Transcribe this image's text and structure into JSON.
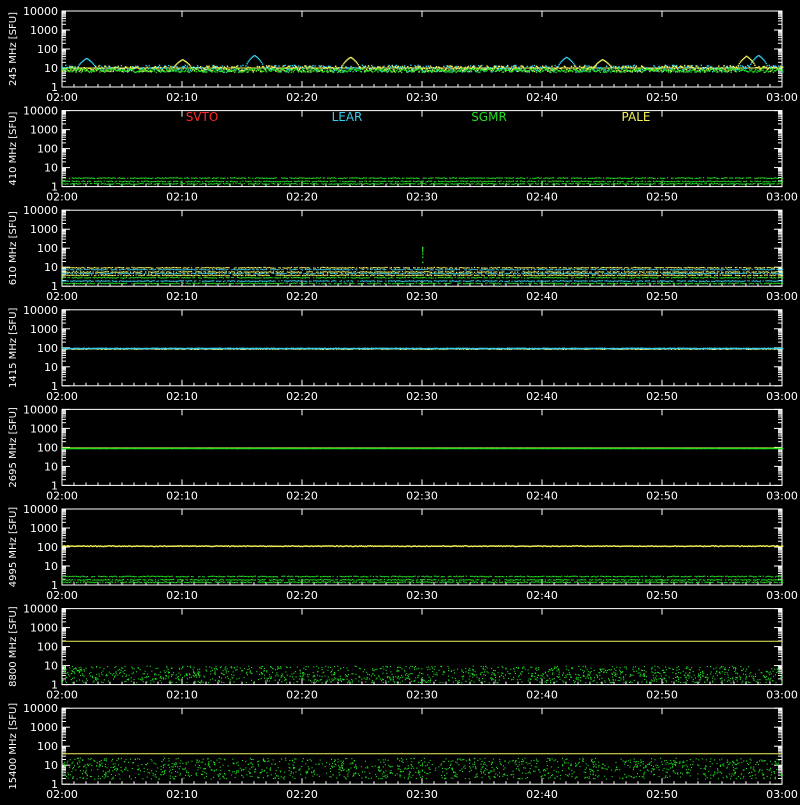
{
  "legend": {
    "items": [
      {
        "label": "SVTO",
        "color": "#ff2a2a"
      },
      {
        "label": "LEAR",
        "color": "#33ccee"
      },
      {
        "label": "SGMR",
        "color": "#22dd22"
      },
      {
        "label": "PALE",
        "color": "#f2f25a"
      }
    ]
  },
  "chart_data": {
    "type": "scatter",
    "x_ticks": [
      "02:00",
      "02:10",
      "02:20",
      "02:30",
      "02:40",
      "02:50",
      "03:00"
    ],
    "xlim_minutes": [
      0,
      60
    ],
    "y_scale": "log",
    "ylim": [
      1,
      10000
    ],
    "y_ticks": [
      "10000",
      "1000",
      "100",
      "10",
      "1"
    ],
    "y_tick_values": [
      10000,
      1000,
      100,
      10,
      1
    ],
    "panels": [
      {
        "ylabel": "245 MHz [SFU]",
        "baseline": 10,
        "series": [
          {
            "name": "LEAR",
            "level": 10,
            "noise": 0.18,
            "spikes": [
              [
                2,
                35
              ],
              [
                16,
                50
              ],
              [
                42,
                40
              ],
              [
                58,
                50
              ]
            ]
          },
          {
            "name": "PALE",
            "level": 10,
            "noise": 0.15,
            "spikes": [
              [
                10,
                30
              ],
              [
                24,
                40
              ],
              [
                45,
                30
              ],
              [
                57,
                45
              ]
            ]
          },
          {
            "name": "SGMR",
            "level": 8,
            "noise": 0.1
          }
        ]
      },
      {
        "ylabel": "410 MHz [SFU]",
        "baseline": null,
        "series": [
          {
            "name": "SGMR",
            "bands": [
              2,
              3,
              1.5
            ]
          }
        ]
      },
      {
        "ylabel": "610 MHz [SFU]",
        "baseline": null,
        "series": [
          {
            "name": "PALE",
            "bands": [
              10,
              6,
              4
            ]
          },
          {
            "name": "LEAR",
            "bands": [
              8,
              5,
              2
            ]
          },
          {
            "name": "SGMR",
            "bands": [
              3,
              1.5
            ],
            "spikes": [
              [
                30,
                120
              ]
            ]
          }
        ]
      },
      {
        "ylabel": "1415 MHz [SFU]",
        "baseline": null,
        "series": [
          {
            "name": "PALE",
            "level": 95,
            "noise": 0.02
          },
          {
            "name": "LEAR",
            "level": 100,
            "noise": 0.015
          }
        ]
      },
      {
        "ylabel": "2695 MHz [SFU]",
        "baseline": 95,
        "series": [
          {
            "name": "SGMR",
            "level": 95,
            "noise": 0.005
          }
        ]
      },
      {
        "ylabel": "4995 MHz [SFU]",
        "baseline": null,
        "series": [
          {
            "name": "PALE",
            "level": 120,
            "noise": 0.02
          },
          {
            "name": "SGMR",
            "bands": [
              3,
              2,
              1.5
            ]
          }
        ]
      },
      {
        "ylabel": "8800 MHz [SFU]",
        "baseline": 190,
        "series": [
          {
            "name": "SGMR",
            "scatter": [
              1.3,
              10
            ]
          }
        ]
      },
      {
        "ylabel": "15400 MHz [SFU]",
        "baseline": 40,
        "series": [
          {
            "name": "SGMR",
            "scatter": [
              2,
              25
            ]
          }
        ]
      }
    ]
  }
}
